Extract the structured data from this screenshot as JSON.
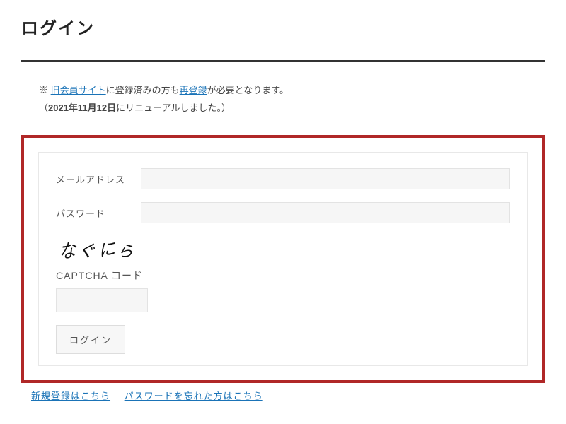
{
  "page": {
    "title": "ログイン"
  },
  "notice": {
    "prefix": "※ ",
    "link1": "旧会員サイト",
    "mid1": "に登録済みの方も",
    "link2": "再登録",
    "suffix1": "が必要となります。",
    "line2_open": "（",
    "line2_bold": "2021年11月12日",
    "line2_rest": "にリニューアルしました。）"
  },
  "form": {
    "email_label": "メールアドレス",
    "password_label": "パスワード",
    "email_value": "",
    "password_value": "",
    "captcha_label": "CAPTCHA コード",
    "captcha_value": "",
    "submit_label": "ログイン"
  },
  "captcha": {
    "glyphs": [
      "な",
      "ぐ",
      "に",
      "ら"
    ]
  },
  "links": {
    "register": "新規登録はこちら",
    "forgot": "パスワードを忘れた方はこちら"
  }
}
